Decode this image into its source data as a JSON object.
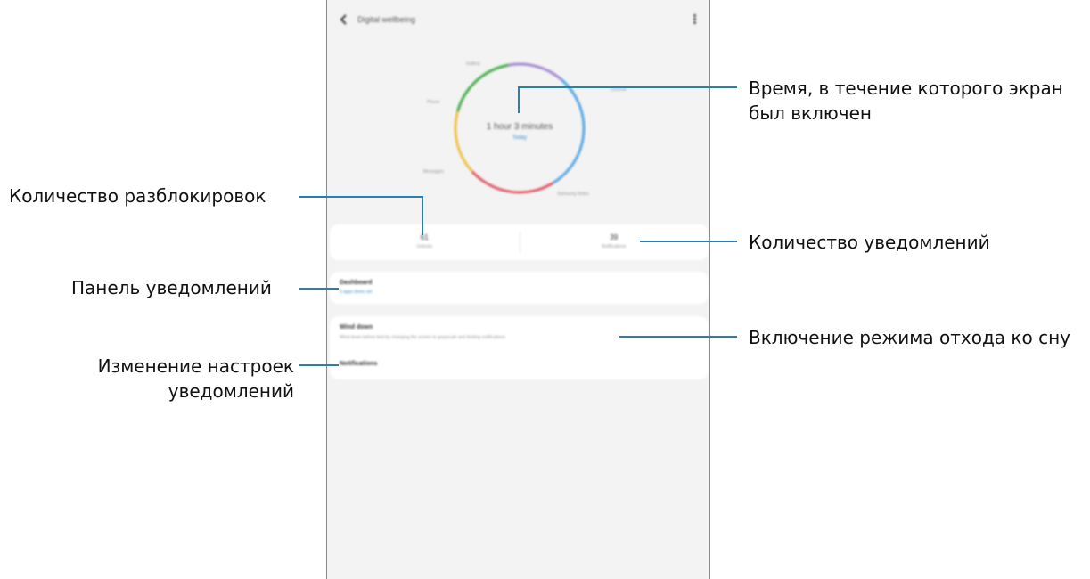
{
  "screen": {
    "topbar": {
      "title": "Digital wellbeing"
    },
    "screen_time": {
      "value": "1 hour 3 minutes",
      "link": "Today"
    },
    "app_labels": [
      "Gallery",
      "Chrome",
      "Phone",
      "Messages",
      "Samsung Notes"
    ],
    "stats": {
      "unlocks": {
        "value": "61",
        "label": "Unlocks"
      },
      "notifications": {
        "value": "39",
        "label": "Notifications"
      }
    },
    "dashboard": {
      "title": "Dashboard",
      "subtitle": "6 apps times set"
    },
    "wind_down": {
      "title": "Wind down",
      "description": "Wind down before bed by changing the screen to grayscale and limiting notifications"
    },
    "notifications_row": {
      "title": "Notifications"
    }
  },
  "annotations": {
    "screen_time": "Время, в течение которого экран был включен",
    "unlocks": "Количество разблокировок",
    "notifications_count": "Количество уведомлений",
    "dashboard": "Панель уведомлений",
    "wind_down": "Включение режима отхода ко сну",
    "notification_settings": "Изменение настроек уведомлений"
  },
  "colors": {
    "callout_line": "#2a7db5",
    "ring": [
      "#a78bd3",
      "#5aa9e6",
      "#e35d6a",
      "#f0c24a",
      "#4caf50"
    ]
  }
}
